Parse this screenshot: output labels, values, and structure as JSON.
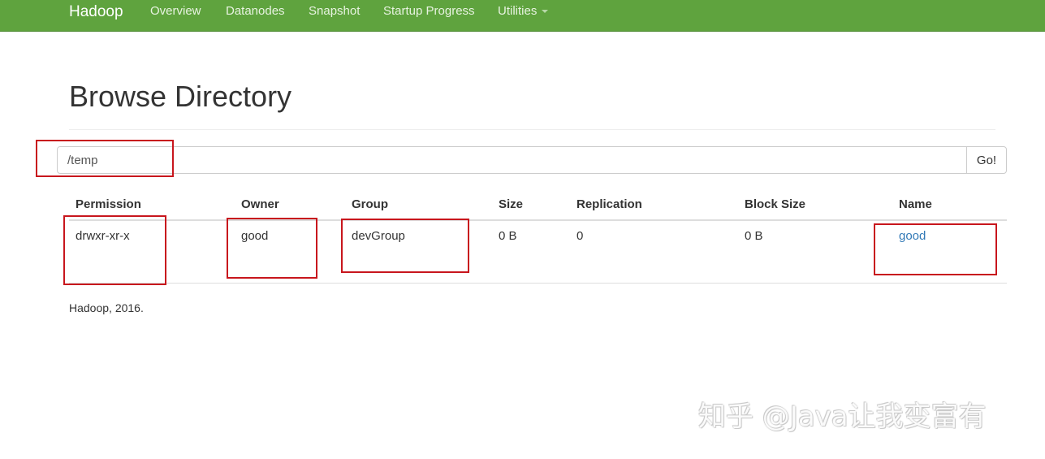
{
  "navbar": {
    "brand": "Hadoop",
    "items": [
      {
        "label": "Overview"
      },
      {
        "label": "Datanodes"
      },
      {
        "label": "Snapshot"
      },
      {
        "label": "Startup Progress"
      },
      {
        "label": "Utilities"
      }
    ],
    "color": "#5fa33e"
  },
  "page": {
    "title": "Browse Directory"
  },
  "search": {
    "value": "/temp",
    "button_label": "Go!"
  },
  "table": {
    "headers": [
      "Permission",
      "Owner",
      "Group",
      "Size",
      "Replication",
      "Block Size",
      "Name"
    ],
    "rows": [
      {
        "permission": "drwxr-xr-x",
        "owner": "good",
        "group": "devGroup",
        "size": "0 B",
        "replication": "0",
        "block_size": "0 B",
        "name": "good"
      }
    ]
  },
  "footer": {
    "text": "Hadoop, 2016."
  },
  "watermark": {
    "text": "知乎 @Java让我变富有"
  },
  "colors": {
    "link": "#337ab7",
    "annotation": "#c8161d"
  }
}
